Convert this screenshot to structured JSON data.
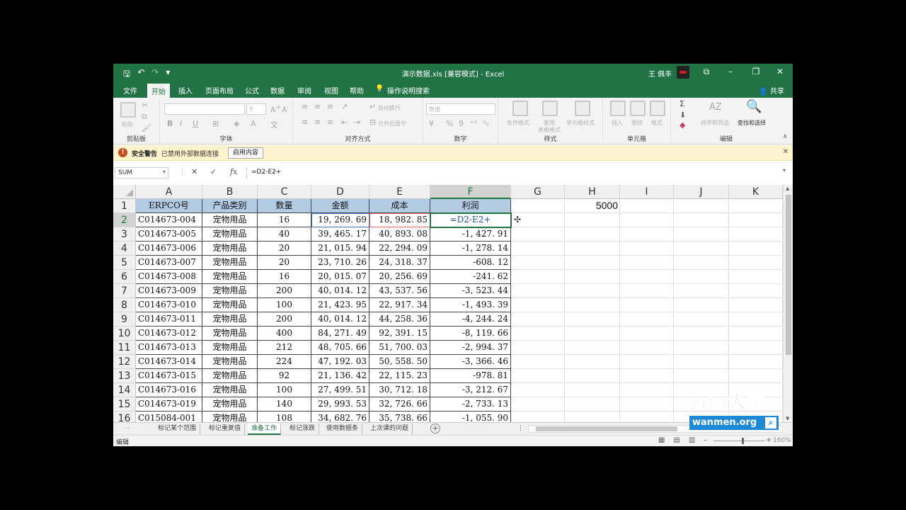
{
  "window": {
    "title": "演示数据.xls  [兼容模式]  -  Excel",
    "user": "王 佩丰",
    "qat": {
      "save": "🖫",
      "undo": "↶",
      "redo": "↷",
      "more": "▾"
    },
    "controls": {
      "ribbon_options": "⧉",
      "minimize": "–",
      "restore": "❐",
      "close": "✕"
    }
  },
  "tabs": [
    "文件",
    "开始",
    "插入",
    "页面布局",
    "公式",
    "数据",
    "审阅",
    "视图",
    "帮助"
  ],
  "active_tab": "开始",
  "tell_me": "操作说明搜索",
  "share": "共享",
  "ribbon": {
    "groups": {
      "clipboard": "剪贴板",
      "font": "字体",
      "alignment": "对齐方式",
      "number": "数字",
      "styles": "样式",
      "cells": "单元格",
      "editing": "编辑"
    },
    "paste": "粘贴",
    "font_size": "9",
    "bold": "B",
    "italic": "I",
    "underline": "U",
    "wrap_text": "自动换行",
    "merge_center": "合并后居中",
    "number_format": "数值",
    "percent": "%",
    "comma": "9",
    "conditional_format": "条件格式",
    "format_as_table_1": "套用",
    "format_as_table_2": "表格格式",
    "cell_styles": "单元格样式",
    "insert": "插入",
    "delete": "删除",
    "format": "格式",
    "sum": "Σ",
    "sort_filter": "排序和筛选",
    "find_select": "查找和选择"
  },
  "security": {
    "title": "安全警告",
    "message": "已禁用外部数据连接",
    "button": "启用内容"
  },
  "formula_bar": {
    "name_box": "SUM",
    "cancel": "✕",
    "enter": "✓",
    "fx": "fx",
    "formula": "=D2-E2+"
  },
  "columns": [
    "A",
    "B",
    "C",
    "D",
    "E",
    "F",
    "G",
    "H",
    "I",
    "J",
    "K"
  ],
  "selected_column": "F",
  "selected_row": "2",
  "header_row": [
    "ERPCO号",
    "产品类别",
    "数量",
    "金额",
    "成本",
    "利润"
  ],
  "h1_value": "5000",
  "rows": [
    {
      "n": "2",
      "a": "C014673-004",
      "b": "宠物用品",
      "c": "16",
      "d": "19, 269. 69",
      "e": "18, 982. 85",
      "f": "=D2-E2+"
    },
    {
      "n": "3",
      "a": "C014673-005",
      "b": "宠物用品",
      "c": "40",
      "d": "39, 465. 17",
      "e": "40, 893. 08",
      "f": "-1, 427. 91"
    },
    {
      "n": "4",
      "a": "C014673-006",
      "b": "宠物用品",
      "c": "20",
      "d": "21, 015. 94",
      "e": "22, 294. 09",
      "f": "-1, 278. 14"
    },
    {
      "n": "5",
      "a": "C014673-007",
      "b": "宠物用品",
      "c": "20",
      "d": "23, 710. 26",
      "e": "24, 318. 37",
      "f": "-608. 12"
    },
    {
      "n": "6",
      "a": "C014673-008",
      "b": "宠物用品",
      "c": "16",
      "d": "20, 015. 07",
      "e": "20, 256. 69",
      "f": "-241. 62"
    },
    {
      "n": "7",
      "a": "C014673-009",
      "b": "宠物用品",
      "c": "200",
      "d": "40, 014. 12",
      "e": "43, 537. 56",
      "f": "-3, 523. 44"
    },
    {
      "n": "8",
      "a": "C014673-010",
      "b": "宠物用品",
      "c": "100",
      "d": "21, 423. 95",
      "e": "22, 917. 34",
      "f": "-1, 493. 39"
    },
    {
      "n": "9",
      "a": "C014673-011",
      "b": "宠物用品",
      "c": "200",
      "d": "40, 014. 12",
      "e": "44, 258. 36",
      "f": "-4, 244. 24"
    },
    {
      "n": "10",
      "a": "C014673-012",
      "b": "宠物用品",
      "c": "400",
      "d": "84, 271. 49",
      "e": "92, 391. 15",
      "f": "-8, 119. 66"
    },
    {
      "n": "11",
      "a": "C014673-013",
      "b": "宠物用品",
      "c": "212",
      "d": "48, 705. 66",
      "e": "51, 700. 03",
      "f": "-2, 994. 37"
    },
    {
      "n": "12",
      "a": "C014673-014",
      "b": "宠物用品",
      "c": "224",
      "d": "47, 192. 03",
      "e": "50, 558. 50",
      "f": "-3, 366. 46"
    },
    {
      "n": "13",
      "a": "C014673-015",
      "b": "宠物用品",
      "c": "92",
      "d": "21, 136. 42",
      "e": "22, 115. 23",
      "f": "-978. 81"
    },
    {
      "n": "14",
      "a": "C014673-016",
      "b": "宠物用品",
      "c": "100",
      "d": "27, 499. 51",
      "e": "30, 712. 18",
      "f": "-3, 212. 67"
    },
    {
      "n": "15",
      "a": "C014673-019",
      "b": "宠物用品",
      "c": "140",
      "d": "29, 993. 53",
      "e": "32, 726. 66",
      "f": "-2, 733. 13"
    },
    {
      "n": "16",
      "a": "C015084-001",
      "b": "宠物用品",
      "c": "108",
      "d": "34, 682. 76",
      "e": "35, 738. 66",
      "f": "-1, 055. 90"
    }
  ],
  "sheets": [
    "标记某个范围",
    "标记重复值",
    "准备工作",
    "标记涨跌",
    "使用数据条",
    "上次课的问题"
  ],
  "active_sheet": "准备工作",
  "status": {
    "mode": "编辑",
    "zoom": "160%"
  },
  "watermark": {
    "brand": "万门大学",
    "site": "wanmen.org"
  },
  "colors": {
    "excel_green": "#217346",
    "header_fill": "#b4cbe4",
    "ref_blue": "#4472c4",
    "ref_red": "#e06666"
  }
}
